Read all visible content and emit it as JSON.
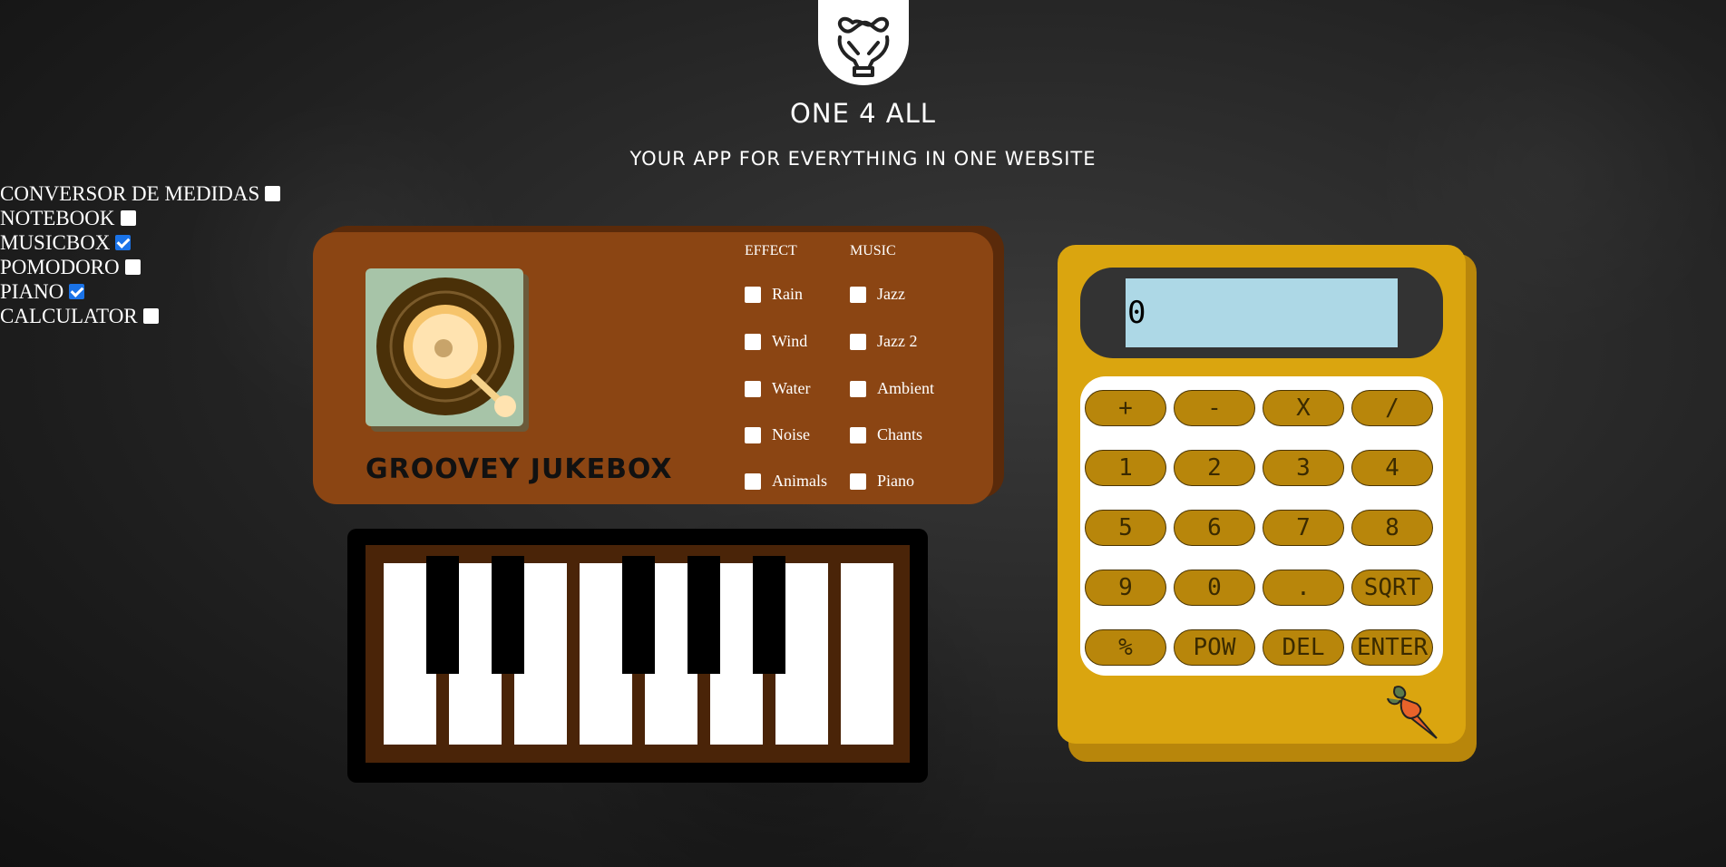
{
  "header": {
    "title": "ONE 4 ALL",
    "subtitle": "YOUR APP FOR EVERYTHING IN ONE WEBSITE",
    "logo_icon": "hands-infinity-icon"
  },
  "toggles": [
    {
      "label": "CONVERSOR DE MEDIDAS",
      "checked": false
    },
    {
      "label": "NOTEBOOK",
      "checked": false
    },
    {
      "label": "MUSICBOX",
      "checked": true
    },
    {
      "label": "POMODORO",
      "checked": false
    },
    {
      "label": "PIANO",
      "checked": true
    },
    {
      "label": "CALCULATOR",
      "checked": false
    }
  ],
  "jukebox": {
    "brand": "GROOVEY JUKEBOX",
    "effect_heading": "EFFECT",
    "music_heading": "MUSIC",
    "effects": [
      "Rain",
      "Wind",
      "Water",
      "Noise",
      "Animals"
    ],
    "music": [
      "Jazz",
      "Jazz 2",
      "Ambient",
      "Chants",
      "Piano"
    ],
    "colors": {
      "body": "#8b4513",
      "turntable_bg": "#a7c4a8"
    }
  },
  "piano": {
    "white_keys": 8,
    "black_keys": 5
  },
  "calculator": {
    "display": "0",
    "keys": [
      [
        "+",
        "-",
        "X",
        "/"
      ],
      [
        "1",
        "2",
        "3",
        "4"
      ],
      [
        "5",
        "6",
        "7",
        "8"
      ],
      [
        "9",
        "0",
        ".",
        "SQRT"
      ],
      [
        "%",
        "POW",
        "DEL",
        "ENTER"
      ]
    ],
    "mascot_icon": "carrot-icon",
    "colors": {
      "body": "#daa50f",
      "key": "#b8860b",
      "screen": "#add8e6"
    }
  }
}
